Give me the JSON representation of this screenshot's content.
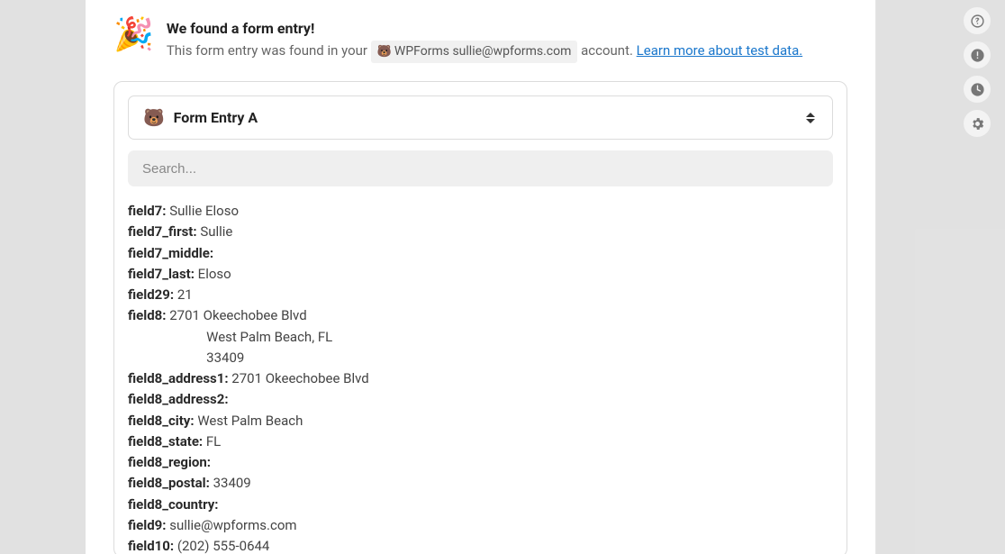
{
  "header": {
    "title": "We found a form entry!",
    "sub_prefix": "This form entry was found in your ",
    "account_label": "WPForms sullie@wpforms.com",
    "sub_suffix": " account. ",
    "learn_link": "Learn more about test data."
  },
  "selector": {
    "title": "Form Entry A"
  },
  "search": {
    "placeholder": "Search..."
  },
  "fields": [
    {
      "key": "field7:",
      "val": " Sullie Eloso"
    },
    {
      "key": "field7_first:",
      "val": " Sullie"
    },
    {
      "key": "field7_middle:",
      "val": ""
    },
    {
      "key": "field7_last:",
      "val": " Eloso"
    },
    {
      "key": "field29:",
      "val": " 21"
    },
    {
      "key": "field8:",
      "val": " 2701 Okeechobee Blvd\n            West Palm Beach, FL\n            33409"
    },
    {
      "key": "field8_address1:",
      "val": " 2701 Okeechobee Blvd"
    },
    {
      "key": "field8_address2:",
      "val": ""
    },
    {
      "key": "field8_city:",
      "val": " West Palm Beach"
    },
    {
      "key": "field8_state:",
      "val": " FL"
    },
    {
      "key": "field8_region:",
      "val": ""
    },
    {
      "key": "field8_postal:",
      "val": " 33409"
    },
    {
      "key": "field8_country:",
      "val": ""
    },
    {
      "key": "field9:",
      "val": " sullie@wpforms.com"
    },
    {
      "key": "field10:",
      "val": " (202) 555-0644"
    }
  ]
}
